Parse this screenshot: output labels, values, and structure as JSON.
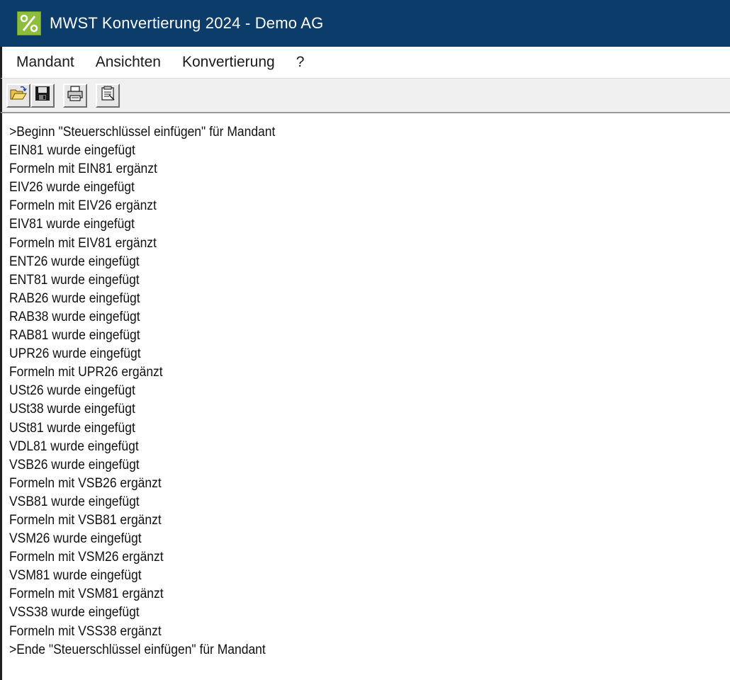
{
  "window": {
    "title": "MWST Konvertierung 2024 - Demo AG",
    "icon": "app-logo-icon",
    "titlebar_color": "#0c3c6a"
  },
  "menu": {
    "items": [
      {
        "label": "Mandant"
      },
      {
        "label": "Ansichten"
      },
      {
        "label": "Konvertierung"
      },
      {
        "label": "?"
      }
    ]
  },
  "toolbar": {
    "buttons": [
      {
        "icon": "open-folder-icon"
      },
      {
        "icon": "save-disk-icon"
      },
      {
        "icon": "print-icon"
      },
      {
        "icon": "properties-icon"
      }
    ]
  },
  "log": {
    "lines": [
      ">Beginn \"Steuerschlüssel einfügen\" für Mandant",
      "EIN81 wurde eingefügt",
      "Formeln mit EIN81 ergänzt",
      "EIV26 wurde eingefügt",
      "Formeln mit EIV26 ergänzt",
      "EIV81 wurde eingefügt",
      "Formeln mit EIV81 ergänzt",
      "ENT26 wurde eingefügt",
      "ENT81 wurde eingefügt",
      "RAB26 wurde eingefügt",
      "RAB38 wurde eingefügt",
      "RAB81 wurde eingefügt",
      "UPR26 wurde eingefügt",
      "Formeln mit UPR26 ergänzt",
      "USt26 wurde eingefügt",
      "USt38 wurde eingefügt",
      "USt81 wurde eingefügt",
      "VDL81 wurde eingefügt",
      "VSB26 wurde eingefügt",
      "Formeln mit VSB26 ergänzt",
      "VSB81 wurde eingefügt",
      "Formeln mit VSB81 ergänzt",
      "VSM26 wurde eingefügt",
      "Formeln mit VSM26 ergänzt",
      "VSM81 wurde eingefügt",
      "Formeln mit VSM81 ergänzt",
      "VSS38 wurde eingefügt",
      "Formeln mit VSS38 ergänzt",
      ">Ende \"Steuerschlüssel einfügen\" für Mandant"
    ]
  }
}
